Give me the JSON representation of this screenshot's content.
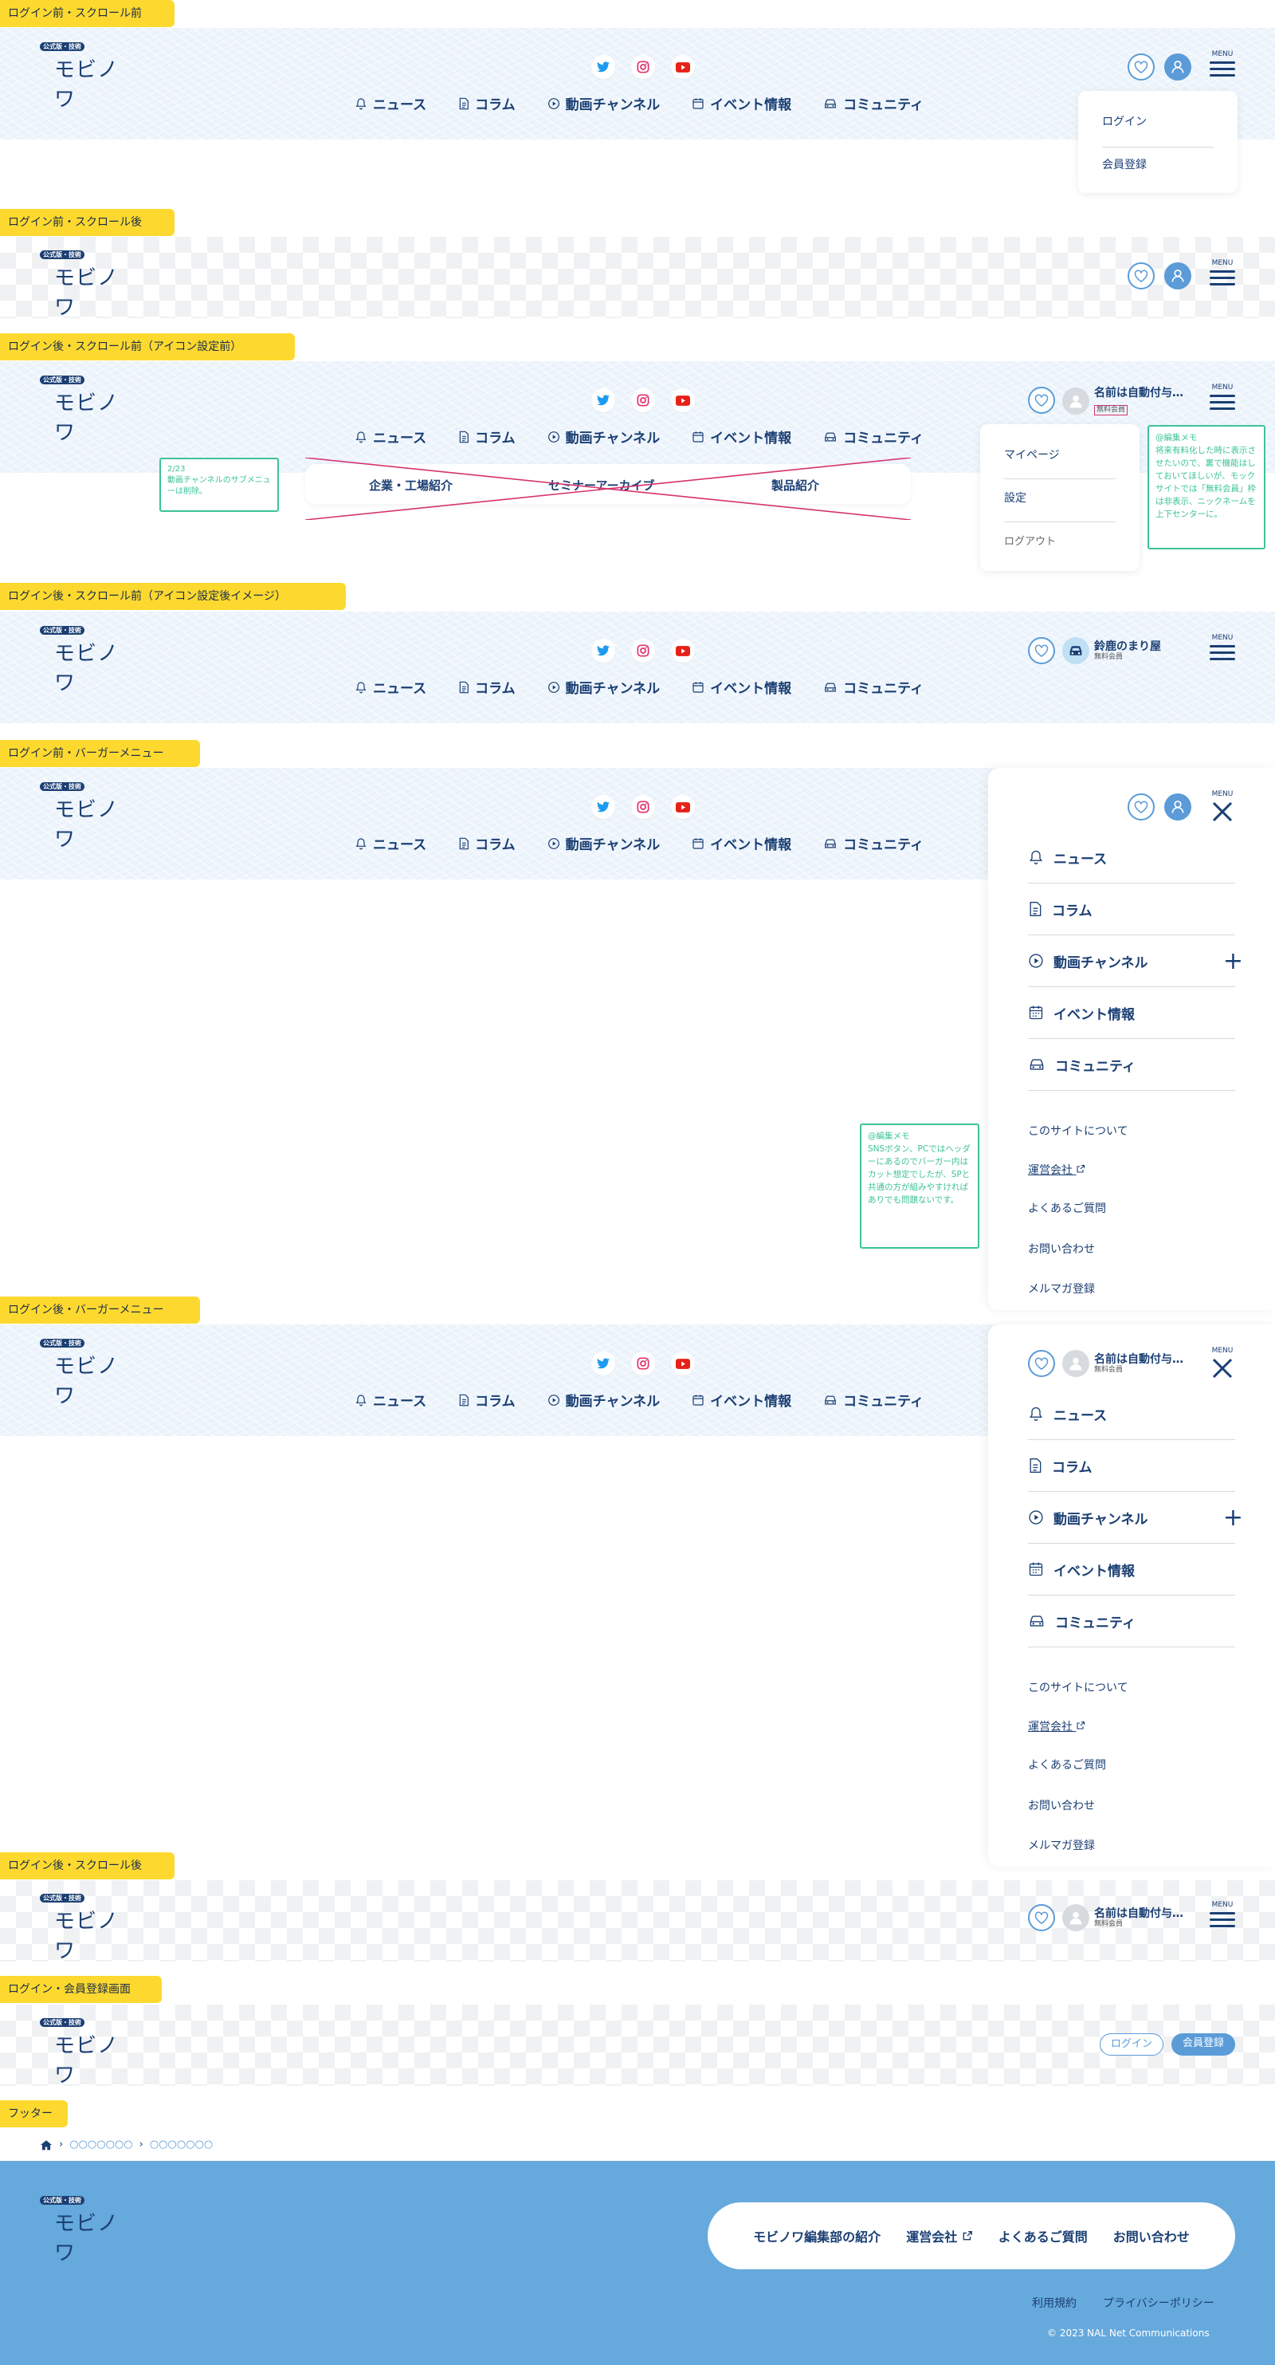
{
  "logo": {
    "badge": "公式版・技術",
    "name": "モビノワ"
  },
  "nav": [
    "ニュース",
    "コラム",
    "動画チャンネル",
    "イベント情報",
    "コミュニティ"
  ],
  "menu_label": "MENU",
  "sections": {
    "s1": "ログイン前・スクロール前",
    "s2": "ログイン前・スクロール後",
    "s3": "ログイン後・スクロール前（アイコン設定前）",
    "s4": "ログイン後・スクロール前（アイコン設定後イメージ）",
    "s5": "ログイン前・バーガーメニュー",
    "s6": "ログイン後・バーガーメニュー",
    "s7": "ログイン後・スクロール後",
    "s8": "ログイン・会員登録画面",
    "s9": "フッター"
  },
  "login_dropdown": [
    "ログイン",
    "会員登録"
  ],
  "user_dropdown": [
    "マイページ",
    "設定",
    "ログアウト"
  ],
  "user_default": {
    "name": "名前は自動付与…",
    "type": "無料会員"
  },
  "user_custom": {
    "name": "鈴鹿のまり屋",
    "type": "無料会員"
  },
  "video_subnav": [
    "企業・工場紹介",
    "セミナーアーカイブ",
    "製品紹介"
  ],
  "memo_removed": "2/23\n動画チャンネルのサブメニューは削除。",
  "memo_name": "@編集メモ\n将来有料化した時に表示させたいので、裏で機能はしておいてほしいが、モックサイトでは「無料会員」枠は非表示、ニックネームを上下センターに。",
  "memo_sns": "@編集メモ\nSNSボタン、PCではヘッダーにあるのでバーガー内はカット想定でしたが、SPと共通の方が組みやすければありでも問題ないです。",
  "burger_items": [
    "ニュース",
    "コラム",
    "動画チャンネル",
    "イベント情報",
    "コミュニティ"
  ],
  "burger_sub": [
    "このサイトについて",
    "運営会社",
    "よくあるご質問",
    "お問い合わせ",
    "メルマガ登録"
  ],
  "auth_buttons": {
    "login": "ログイン",
    "register": "会員登録"
  },
  "breadcrumb": [
    "○○○○○○○",
    "○○○○○○○"
  ],
  "footer": {
    "links": [
      "モビノワ編集部の紹介",
      "運営会社",
      "よくあるご質問",
      "お問い合わせ"
    ],
    "legal": [
      "利用規約",
      "プライバシーポリシー"
    ],
    "copyright": "© 2023 NAL Net Communications"
  },
  "colors": {
    "navy": "#1b3f73",
    "accent": "#5a9bd8",
    "tag": "#fdd92f",
    "memo": "#3cc39a",
    "footer_bg": "#66a9dc",
    "twitter": "#1d9bf0",
    "instagram": "#e1306c",
    "youtube": "#e62117",
    "cross": "#d6336c"
  }
}
